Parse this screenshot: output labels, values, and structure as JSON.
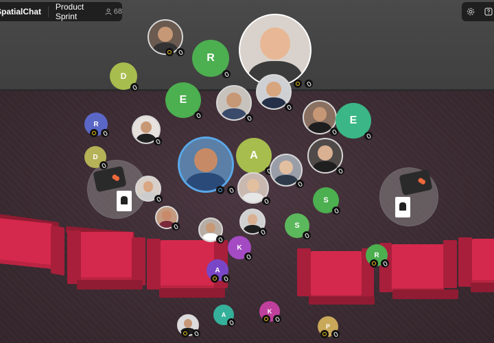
{
  "header": {
    "brand": "SpatialChat",
    "room_name": "Product Sprint",
    "people_count": "68"
  },
  "toolbar": {
    "settings_icon": "gear-icon",
    "help_icon": "help-icon"
  },
  "colors": {
    "wall": "#444444",
    "floor": "#3a2b32",
    "chairs": "#d4294c",
    "speaker_ring": "#5aa8e8"
  },
  "participants": [
    {
      "initial": "",
      "color": "#6a5a50",
      "skin": "#c79876",
      "shirt": "#333333",
      "hand": true
    },
    {
      "initial": "R",
      "color": "#4caf50"
    },
    {
      "initial": "",
      "color": "#d9d2cc",
      "skin": "#e8b896",
      "shirt": "#3b3b3b",
      "hand": true
    },
    {
      "initial": "D",
      "color": "#a7bd4e"
    },
    {
      "initial": "E",
      "color": "#4caf50"
    },
    {
      "initial": "",
      "color": "#c8c2bc",
      "skin": "#c79876",
      "shirt": "#3a4a6a"
    },
    {
      "initial": "",
      "color": "#cfd0d4",
      "skin": "#d7a67e",
      "shirt": "#253048"
    },
    {
      "initial": "",
      "color": "#8a7060",
      "skin": "#c79876",
      "shirt": "#1e1e1e"
    },
    {
      "initial": "E",
      "color": "#3bb787"
    },
    {
      "initial": "R",
      "color": "#5b67c7",
      "hand": true
    },
    {
      "initial": "",
      "color": "#e6e1dd",
      "skin": "#c79876",
      "shirt": "#202020"
    },
    {
      "initial": "",
      "color": "#5b7fa6",
      "skin": "#c68a66",
      "shirt": "#2a4a7a",
      "speaker": true
    },
    {
      "initial": "A",
      "color": "#a7bd4e"
    },
    {
      "initial": "",
      "color": "#9a9ea8",
      "skin": "#e2bf9f",
      "shirt": "#2e3a4a"
    },
    {
      "initial": "D",
      "color": "#b5b257"
    },
    {
      "initial": "",
      "color": "#4f4a48",
      "skin": "#d9b092",
      "shirt": "#1f1f1f"
    },
    {
      "initial": "",
      "color": "#c9b8b0",
      "skin": "#e2bf9f",
      "shirt": "#e6e6e6"
    },
    {
      "initial": "",
      "color": "#d8cfc8",
      "skin": "#d9a683",
      "shirt": "#cccccc"
    },
    {
      "initial": "S",
      "color": "#4caf50"
    },
    {
      "initial": "",
      "color": "#c49a80",
      "skin": "#c88a6a",
      "shirt": "#7a2a3a"
    },
    {
      "initial": "S",
      "color": "#5cb85c"
    },
    {
      "initial": "",
      "color": "#b7ada5",
      "skin": "#c79876",
      "shirt": "#ffffff"
    },
    {
      "initial": "",
      "color": "#d0d0d0",
      "skin": "#d9b092",
      "shirt": "#1f1f1f"
    },
    {
      "initial": "K",
      "color": "#a44bc4"
    },
    {
      "initial": "R",
      "color": "#4caf50",
      "hand": true
    },
    {
      "initial": "A",
      "color": "#7a46c8",
      "hand": true
    },
    {
      "initial": "A",
      "color": "#35b09a"
    },
    {
      "initial": "K",
      "color": "#bf3f9c",
      "hand": true
    },
    {
      "initial": "",
      "color": "#dcdcdc",
      "skin": "#c79876",
      "shirt": "#1f1f1f",
      "hand": true
    },
    {
      "initial": "P",
      "color": "#c9a85a",
      "hand": true
    }
  ]
}
